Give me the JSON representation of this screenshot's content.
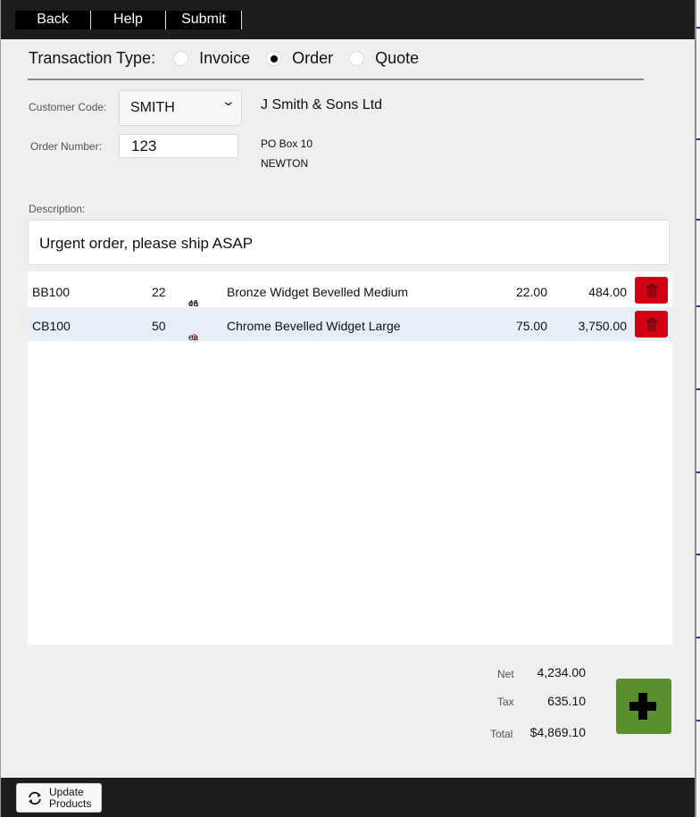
{
  "toolbar": {
    "back_label": "Back",
    "help_label": "Help",
    "submit_label": "Submit"
  },
  "transaction_type": {
    "label": "Transaction Type:",
    "options": [
      {
        "label": "Invoice",
        "selected": false
      },
      {
        "label": "Order",
        "selected": true
      },
      {
        "label": "Quote",
        "selected": false
      }
    ]
  },
  "customer": {
    "code_label": "Customer Code:",
    "code_value": "SMITH",
    "name": "J Smith & Sons Ltd",
    "address_line1": "PO Box 10",
    "address_line2": "NEWTON"
  },
  "order": {
    "number_label": "Order Number:",
    "number_value": "123"
  },
  "description": {
    "label": "Description:",
    "value": "Urgent order, please ship ASAP"
  },
  "lines": [
    {
      "code": "BB100",
      "qty": "22",
      "stock": "46",
      "unit": "ea",
      "stock_negative": false,
      "description": "Bronze Widget Bevelled Medium",
      "price": "22.00",
      "amount": "484.00"
    },
    {
      "code": "CB100",
      "qty": "50",
      "stock": "-6",
      "unit": "ea",
      "stock_negative": true,
      "description": "Chrome Bevelled Widget Large",
      "price": "75.00",
      "amount": "3,750.00"
    }
  ],
  "totals": {
    "net_label": "Net",
    "net_value": "4,234.00",
    "tax_label": "Tax",
    "tax_value": "635.10",
    "total_label": "Total",
    "total_value": "$4,869.10"
  },
  "footer": {
    "update_line1": "Update",
    "update_line2": "Products"
  },
  "icons": {
    "delete": "trash-icon",
    "add": "plus-icon",
    "refresh": "refresh-icon",
    "dropdown": "chevron-down-icon"
  },
  "colors": {
    "delete_button": "#d30015",
    "add_button": "#5a8f2e",
    "alt_row": "#e6eef8",
    "negative_stock": "#e01020",
    "bar_background": "#1c1c1c"
  }
}
